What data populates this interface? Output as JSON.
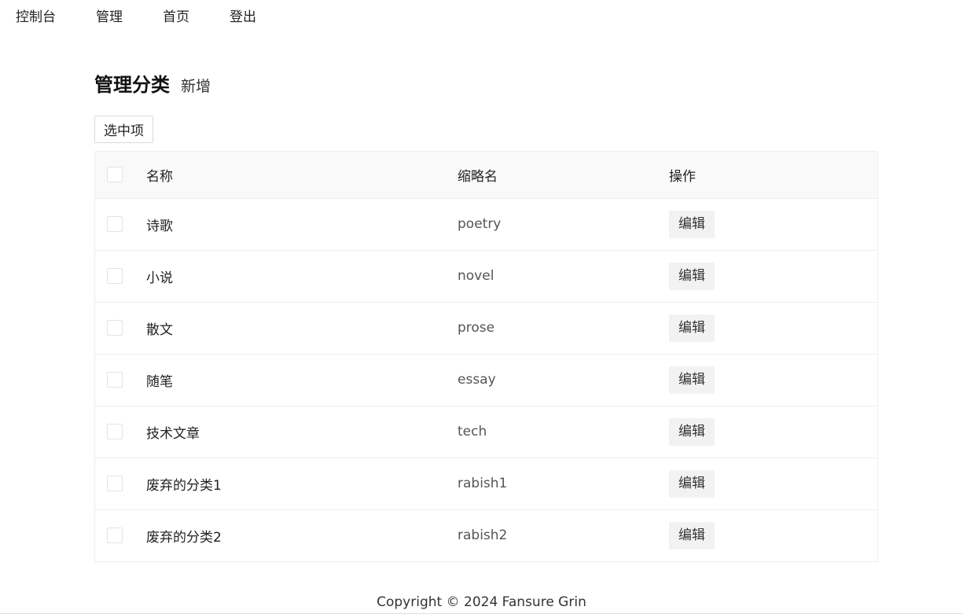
{
  "nav": {
    "items": [
      "控制台",
      "管理",
      "首页",
      "登出"
    ]
  },
  "header": {
    "title": "管理分类",
    "add_label": "新增"
  },
  "toolbar": {
    "selected_label": "选中项"
  },
  "table": {
    "columns": [
      "名称",
      "缩略名",
      "操作"
    ],
    "rows": [
      {
        "name": "诗歌",
        "slug": "poetry",
        "action": "编辑"
      },
      {
        "name": "小说",
        "slug": "novel",
        "action": "编辑"
      },
      {
        "name": "散文",
        "slug": "prose",
        "action": "编辑"
      },
      {
        "name": "随笔",
        "slug": "essay",
        "action": "编辑"
      },
      {
        "name": "技术文章",
        "slug": "tech",
        "action": "编辑"
      },
      {
        "name": "废弃的分类1",
        "slug": "rabish1",
        "action": "编辑"
      },
      {
        "name": "废弃的分类2",
        "slug": "rabish2",
        "action": "编辑"
      }
    ]
  },
  "footer": {
    "copyright": "Copyright © 2024 Fansure Grin"
  }
}
